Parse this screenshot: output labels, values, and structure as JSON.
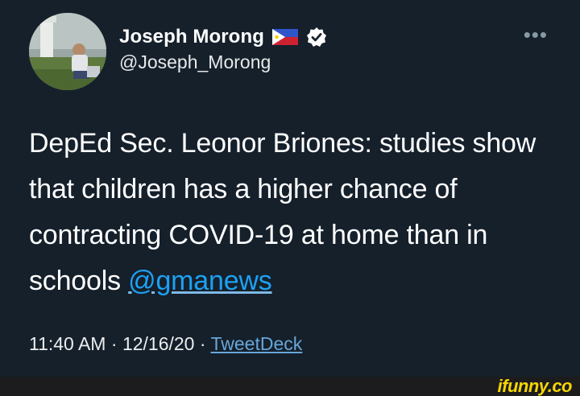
{
  "tweet": {
    "display_name": "Joseph Morong",
    "handle": "@Joseph_Morong",
    "more_label": "•••",
    "text_before_mention": "DepEd Sec. Leonor Briones: studies show that children has a higher chance of contracting COVID-19 at home than in schools ",
    "mention": "@gmanews",
    "time": "11:40 AM",
    "separator": " · ",
    "date": "12/16/20",
    "source": "TweetDeck",
    "icons": {
      "avatar": "profile-photo",
      "flag": "philippines-flag-icon",
      "verified": "verified-badge-icon",
      "more": "more-options-icon"
    }
  },
  "watermark": {
    "text": "ifunny.co",
    "color": "#f6d600"
  },
  "colors": {
    "background": "#15202b",
    "link": "#1da1f2",
    "verified": "#ffffff"
  }
}
